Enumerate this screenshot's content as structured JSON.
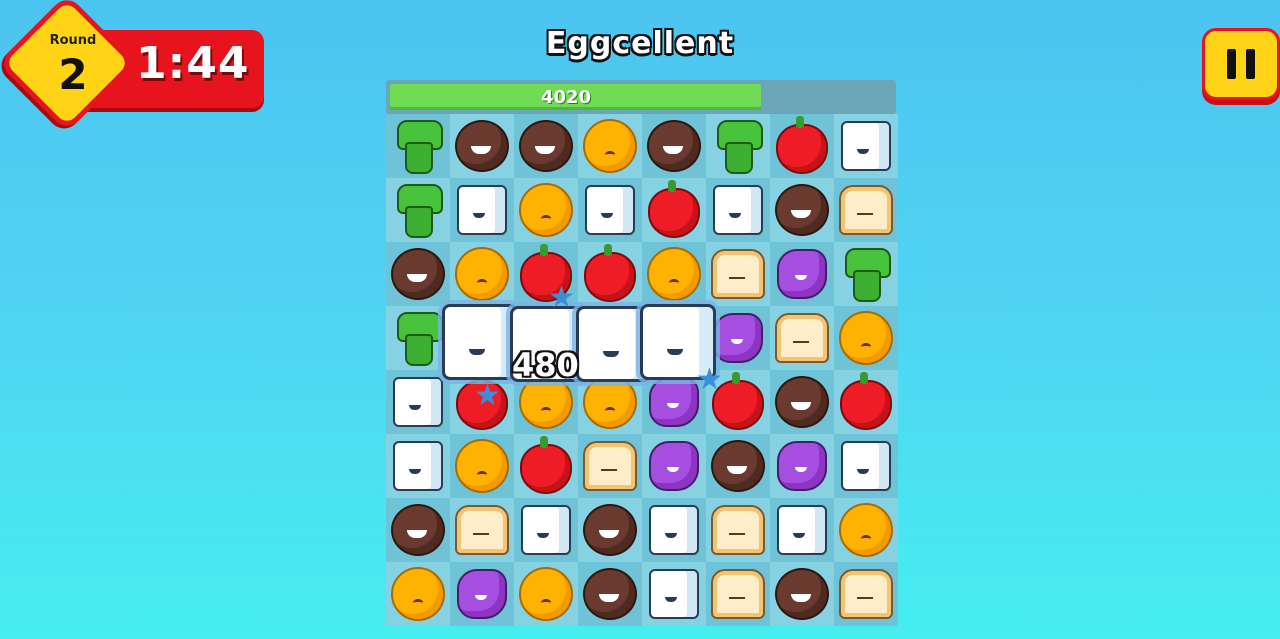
{
  "hud": {
    "round_label": "Round",
    "round_number": "2",
    "timer": "1:44",
    "colors": {
      "badge_yellow": "#ffd416",
      "badge_red": "#e8141d"
    }
  },
  "title": "Eggcellent",
  "score": {
    "value": "4020",
    "progress": 0.74
  },
  "combo_popup": "480",
  "pause_icon": "pause-icon",
  "board": [
    [
      "broccoli",
      "coconut",
      "coconut",
      "orange",
      "coconut",
      "broccoli",
      "apple",
      "milk"
    ],
    [
      "broccoli",
      "milk",
      "orange",
      "milk",
      "apple",
      "milk",
      "coconut",
      "bread"
    ],
    [
      "coconut",
      "orange",
      "apple",
      "apple",
      "orange",
      "bread",
      "grape",
      "broccoli"
    ],
    [
      "broccoli",
      "milk",
      "milk",
      "milk",
      "milk",
      "grape",
      "bread",
      "orange"
    ],
    [
      "milk",
      "apple",
      "orange",
      "orange",
      "grape",
      "apple",
      "coconut",
      "apple"
    ],
    [
      "milk",
      "orange",
      "apple",
      "bread",
      "grape",
      "coconut",
      "grape",
      "milk"
    ],
    [
      "coconut",
      "bread",
      "milk",
      "coconut",
      "milk",
      "bread",
      "milk",
      "orange"
    ],
    [
      "orange",
      "grape",
      "orange",
      "coconut",
      "milk",
      "bread",
      "coconut",
      "bread"
    ]
  ]
}
